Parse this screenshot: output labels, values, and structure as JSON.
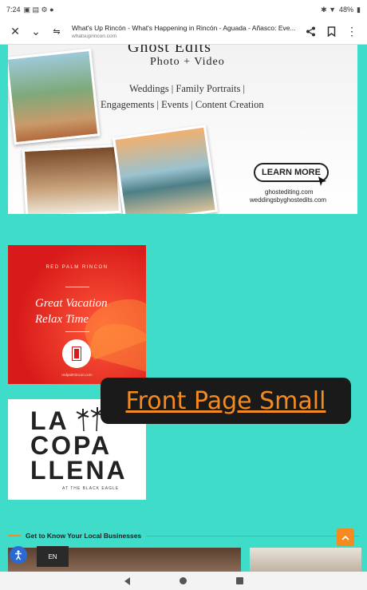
{
  "status": {
    "time": "7:24",
    "battery": "48%"
  },
  "browser": {
    "page_title": "What's Up Rincón - What's Happening in Rincón - Aguada - Añasco: Eve...",
    "domain": "whatsuprincon.com"
  },
  "ghost_ad": {
    "brand": "Ghost Edits",
    "subtitle": "Photo + Video",
    "services_line1": "Weddings | Family Portraits |",
    "services_line2": "Engagements | Events | Content Creation",
    "cta": "LEARN MORE",
    "website1": "ghostediting.com",
    "website2": "weddingsbyghostedits.com"
  },
  "red_palm_ad": {
    "title": "RED PALM RINCON",
    "tagline1": "Great Vacation",
    "tagline2": "Relax Time",
    "url": "redpalmrincon.com"
  },
  "tooltip": {
    "text": "Front Page Small"
  },
  "copa_ad": {
    "line1": "LA",
    "line2": "COPA",
    "line3": "LLENA",
    "sub": "AT THE BLACK EAGLE"
  },
  "section": {
    "heading": "Get to Know Your Local Businesses"
  },
  "language": {
    "label": "EN"
  },
  "colors": {
    "background": "#3fdcc9",
    "accent": "#f58a1f",
    "red_ad": "#d81a1a"
  }
}
